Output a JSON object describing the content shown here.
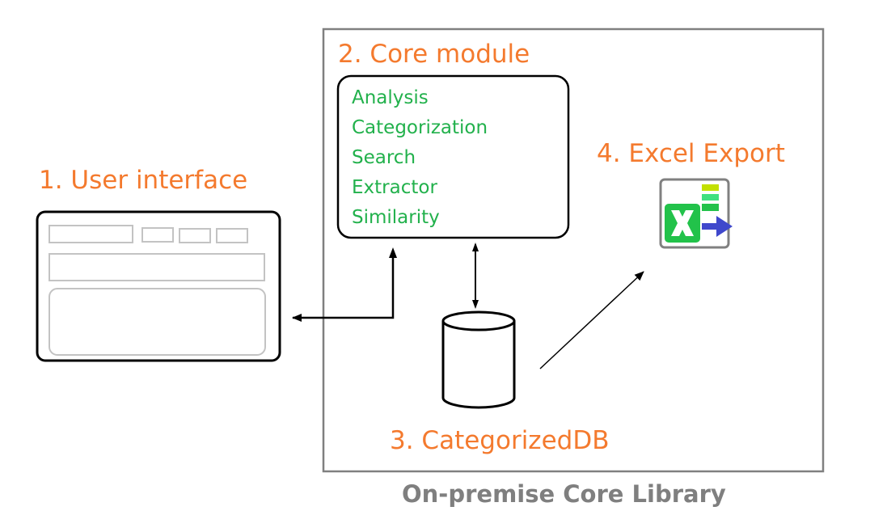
{
  "labels": {
    "user_interface": "1. User interface",
    "core_module": "2. Core module",
    "categorized_db": "3. CategorizedDB",
    "excel_export": "4. Excel Export",
    "container": "On-premise Core Library"
  },
  "core_module_items": [
    "Analysis",
    "Categorization",
    "Search",
    "Extractor",
    "Similarity"
  ],
  "colors": {
    "label": "#f47a2e",
    "item": "#22b14c",
    "container_border": "#808080",
    "excel_green": "#22c24a",
    "excel_arrow": "#3f48cc"
  },
  "icons": {
    "excel": "excel-export-icon",
    "database": "database-cylinder-icon",
    "ui": "ui-wireframe-icon"
  }
}
